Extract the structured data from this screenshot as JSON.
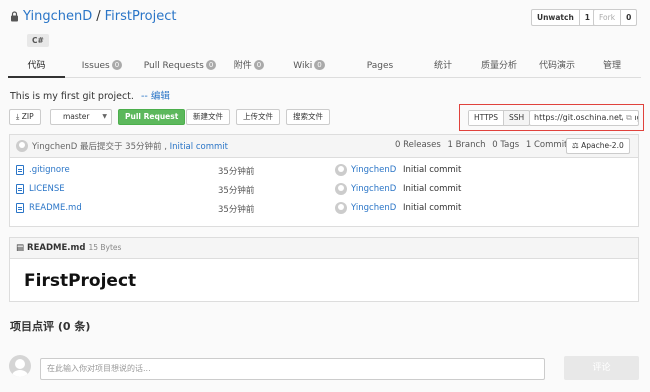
{
  "repo": {
    "owner": "YingchenD",
    "separator": "/",
    "name": "FirstProject",
    "language": "C#"
  },
  "watch": {
    "label": "Unwatch",
    "count": "1"
  },
  "fork": {
    "label": "Fork",
    "count": "0"
  },
  "tabs": [
    {
      "label": "代码"
    },
    {
      "label": "Issues",
      "badge": "0"
    },
    {
      "label": "Pull Requests",
      "badge": "0"
    },
    {
      "label": "附件",
      "badge": "0"
    },
    {
      "label": "Wiki",
      "badge": "0"
    },
    {
      "label": "Pages"
    },
    {
      "label": "统计"
    },
    {
      "label": "质量分析"
    },
    {
      "label": "代码演示"
    },
    {
      "label": "管理"
    }
  ],
  "description": {
    "text": "This is my first git project.",
    "edit": "-- 编辑"
  },
  "toolbar": {
    "zip": "ZIP",
    "branch": "master",
    "pull_request": "Pull Request",
    "new_file": "新建文件",
    "upload": "上传文件",
    "search": "搜索文件"
  },
  "clone": {
    "https": "HTTPS",
    "ssh": "SSH",
    "url": "https://git.oschina.net/YingchenD/FirstProject.git"
  },
  "last_commit": {
    "user": "YingchenD",
    "when": "最后提交于 35分钟前",
    "message": "Initial commit"
  },
  "stats": {
    "releases": "0 Releases",
    "branches": "1 Branch",
    "tags": "0 Tags",
    "commits": "1 Commit",
    "license": "Apache-2.0"
  },
  "files": [
    {
      "name": ".gitignore",
      "time": "35分钟前",
      "user": "YingchenD",
      "message": "Initial commit"
    },
    {
      "name": "LICENSE",
      "time": "35分钟前",
      "user": "YingchenD",
      "message": "Initial commit"
    },
    {
      "name": "README.md",
      "time": "35分钟前",
      "user": "YingchenD",
      "message": "Initial commit"
    }
  ],
  "readme": {
    "filename": "README.md",
    "size": "15 Bytes",
    "heading": "FirstProject"
  },
  "comments": {
    "title": "项目点评 (0 条)",
    "placeholder": "在此输入你对项目想说的话...",
    "submit": "评论"
  }
}
